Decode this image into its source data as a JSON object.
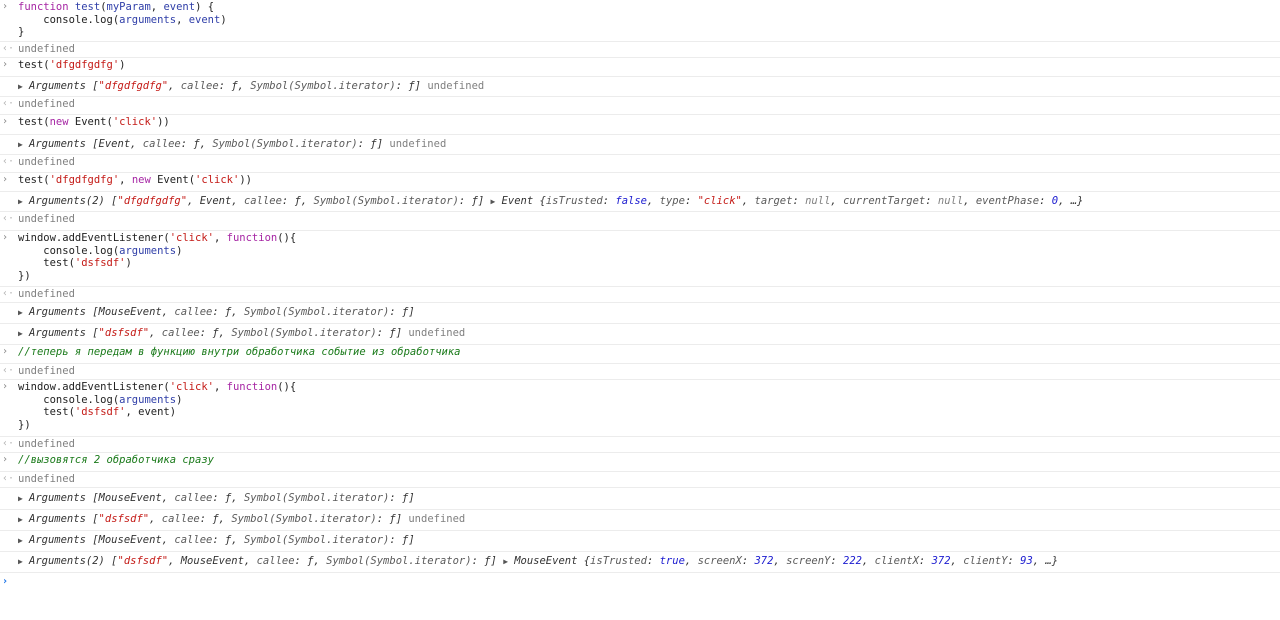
{
  "symbols": {
    "input": "›",
    "result": "‹·",
    "expand": "▶",
    "prompt": "›"
  },
  "icons": {
    "input": "chevron-right-icon",
    "result": "return-arrow-icon",
    "expand": "expand-triangle-icon",
    "prompt": "prompt-caret-icon"
  },
  "colors": {
    "keyword": "#a626a4",
    "function_name": "#2f3ea8",
    "string": "#c41a16",
    "comment": "#1a7a1a",
    "undefined": "#808080",
    "number": "#1c1cd0",
    "prompt": "#1a73e8"
  },
  "console": {
    "entries": [
      {
        "kind": "input",
        "lines": [
          [
            [
              "k",
              "function"
            ],
            [
              "p",
              " "
            ],
            [
              "fn",
              "test"
            ],
            [
              "p",
              "("
            ],
            [
              "fn",
              "myParam"
            ],
            [
              "p",
              ", "
            ],
            [
              "fn",
              "event"
            ],
            [
              "p",
              ") {"
            ]
          ],
          [
            [
              "p",
              "    console.log("
            ],
            [
              "fn",
              "arguments"
            ],
            [
              "p",
              ", "
            ],
            [
              "fn",
              "event"
            ],
            [
              "p",
              ")"
            ]
          ],
          [
            [
              "p",
              "}"
            ]
          ]
        ]
      },
      {
        "kind": "result",
        "lines": [
          [
            [
              "u",
              "undefined"
            ]
          ]
        ]
      },
      {
        "kind": "input",
        "lines": [
          [
            [
              "p",
              "test("
            ],
            [
              "s",
              "'dfgdfgdfg'"
            ],
            [
              "p",
              ")"
            ]
          ]
        ]
      },
      {
        "kind": "log",
        "lines": [
          [
            [
              "t",
              "▶"
            ],
            [
              "o",
              "Arguments ["
            ],
            [
              "ps",
              "\"dfgdfgdfg\""
            ],
            [
              "o",
              ", "
            ],
            [
              "ok",
              "callee"
            ],
            [
              "o",
              ": ƒ, "
            ],
            [
              "ok",
              "Symbol(Symbol.iterator)"
            ],
            [
              "o",
              ": ƒ]"
            ],
            [
              "p",
              " "
            ],
            [
              "u",
              "undefined"
            ]
          ]
        ]
      },
      {
        "kind": "result",
        "lines": [
          [
            [
              "u",
              "undefined"
            ]
          ]
        ]
      },
      {
        "kind": "input",
        "lines": [
          [
            [
              "p",
              "test("
            ],
            [
              "k",
              "new"
            ],
            [
              "p",
              " Event("
            ],
            [
              "s",
              "'click'"
            ],
            [
              "p",
              "))"
            ]
          ]
        ]
      },
      {
        "kind": "log",
        "lines": [
          [
            [
              "t",
              "▶"
            ],
            [
              "o",
              "Arguments [Event, "
            ],
            [
              "ok",
              "callee"
            ],
            [
              "o",
              ": ƒ, "
            ],
            [
              "ok",
              "Symbol(Symbol.iterator)"
            ],
            [
              "o",
              ": ƒ]"
            ],
            [
              "p",
              " "
            ],
            [
              "u",
              "undefined"
            ]
          ]
        ]
      },
      {
        "kind": "result",
        "lines": [
          [
            [
              "u",
              "undefined"
            ]
          ]
        ]
      },
      {
        "kind": "input",
        "lines": [
          [
            [
              "p",
              "test("
            ],
            [
              "s",
              "'dfgdfgdfg'"
            ],
            [
              "p",
              ", "
            ],
            [
              "k",
              "new"
            ],
            [
              "p",
              " Event("
            ],
            [
              "s",
              "'click'"
            ],
            [
              "p",
              "))"
            ]
          ]
        ]
      },
      {
        "kind": "log",
        "lines": [
          [
            [
              "t",
              "▶"
            ],
            [
              "o",
              "Arguments(2) ["
            ],
            [
              "ps",
              "\"dfgdfgdfg\""
            ],
            [
              "o",
              ", Event, "
            ],
            [
              "ok",
              "callee"
            ],
            [
              "o",
              ": ƒ, "
            ],
            [
              "ok",
              "Symbol(Symbol.iterator)"
            ],
            [
              "o",
              ": ƒ]"
            ],
            [
              "p",
              " "
            ],
            [
              "t",
              "▶"
            ],
            [
              "o",
              "Event {"
            ],
            [
              "ok",
              "isTrusted"
            ],
            [
              "o",
              ": "
            ],
            [
              "b",
              "false"
            ],
            [
              "o",
              ", "
            ],
            [
              "ok",
              "type"
            ],
            [
              "o",
              ": "
            ],
            [
              "ps",
              "\"click\""
            ],
            [
              "o",
              ", "
            ],
            [
              "ok",
              "target"
            ],
            [
              "o",
              ": "
            ],
            [
              "n",
              "null"
            ],
            [
              "o",
              ", "
            ],
            [
              "ok",
              "currentTarget"
            ],
            [
              "o",
              ": "
            ],
            [
              "n",
              "null"
            ],
            [
              "o",
              ", "
            ],
            [
              "ok",
              "eventPhase"
            ],
            [
              "o",
              ": "
            ],
            [
              "num",
              "0"
            ],
            [
              "o",
              ", …}"
            ]
          ]
        ]
      },
      {
        "kind": "result",
        "lines": [
          [
            [
              "u",
              "undefined"
            ]
          ]
        ]
      },
      {
        "kind": "input",
        "lines": [
          [
            [
              "p",
              "window.addEventListener("
            ],
            [
              "s",
              "'click'"
            ],
            [
              "p",
              ", "
            ],
            [
              "k",
              "function"
            ],
            [
              "p",
              "(){"
            ]
          ],
          [
            [
              "p",
              "    console.log("
            ],
            [
              "fn",
              "arguments"
            ],
            [
              "p",
              ")"
            ]
          ],
          [
            [
              "p",
              "    test("
            ],
            [
              "s",
              "'dsfsdf'"
            ],
            [
              "p",
              ")"
            ]
          ],
          [
            [
              "p",
              "})"
            ]
          ]
        ]
      },
      {
        "kind": "result",
        "lines": [
          [
            [
              "u",
              "undefined"
            ]
          ]
        ]
      },
      {
        "kind": "log",
        "lines": [
          [
            [
              "t",
              "▶"
            ],
            [
              "o",
              "Arguments [MouseEvent, "
            ],
            [
              "ok",
              "callee"
            ],
            [
              "o",
              ": ƒ, "
            ],
            [
              "ok",
              "Symbol(Symbol.iterator)"
            ],
            [
              "o",
              ": ƒ]"
            ]
          ]
        ]
      },
      {
        "kind": "log",
        "lines": [
          [
            [
              "t",
              "▶"
            ],
            [
              "o",
              "Arguments ["
            ],
            [
              "ps",
              "\"dsfsdf\""
            ],
            [
              "o",
              ", "
            ],
            [
              "ok",
              "callee"
            ],
            [
              "o",
              ": ƒ, "
            ],
            [
              "ok",
              "Symbol(Symbol.iterator)"
            ],
            [
              "o",
              ": ƒ]"
            ],
            [
              "p",
              " "
            ],
            [
              "u",
              "undefined"
            ]
          ]
        ]
      },
      {
        "kind": "input",
        "lines": [
          [
            [
              "c",
              "//теперь я передам в функцию внутри обработчика событие из обработчика"
            ]
          ]
        ]
      },
      {
        "kind": "result",
        "lines": [
          [
            [
              "u",
              "undefined"
            ]
          ]
        ]
      },
      {
        "kind": "input",
        "lines": [
          [
            [
              "p",
              "window.addEventListener("
            ],
            [
              "s",
              "'click'"
            ],
            [
              "p",
              ", "
            ],
            [
              "k",
              "function"
            ],
            [
              "p",
              "(){"
            ]
          ],
          [
            [
              "p",
              "    console.log("
            ],
            [
              "fn",
              "arguments"
            ],
            [
              "p",
              ")"
            ]
          ],
          [
            [
              "p",
              "    test("
            ],
            [
              "s",
              "'dsfsdf'"
            ],
            [
              "p",
              ", event)"
            ]
          ],
          [
            [
              "p",
              "})"
            ]
          ]
        ]
      },
      {
        "kind": "result",
        "lines": [
          [
            [
              "u",
              "undefined"
            ]
          ]
        ]
      },
      {
        "kind": "input",
        "lines": [
          [
            [
              "c",
              "//вызовятся 2 обработчика сразу"
            ]
          ]
        ]
      },
      {
        "kind": "result",
        "lines": [
          [
            [
              "u",
              "undefined"
            ]
          ]
        ]
      },
      {
        "kind": "log",
        "lines": [
          [
            [
              "t",
              "▶"
            ],
            [
              "o",
              "Arguments [MouseEvent, "
            ],
            [
              "ok",
              "callee"
            ],
            [
              "o",
              ": ƒ, "
            ],
            [
              "ok",
              "Symbol(Symbol.iterator)"
            ],
            [
              "o",
              ": ƒ]"
            ]
          ]
        ]
      },
      {
        "kind": "log",
        "lines": [
          [
            [
              "t",
              "▶"
            ],
            [
              "o",
              "Arguments ["
            ],
            [
              "ps",
              "\"dsfsdf\""
            ],
            [
              "o",
              ", "
            ],
            [
              "ok",
              "callee"
            ],
            [
              "o",
              ": ƒ, "
            ],
            [
              "ok",
              "Symbol(Symbol.iterator)"
            ],
            [
              "o",
              ": ƒ]"
            ],
            [
              "p",
              " "
            ],
            [
              "u",
              "undefined"
            ]
          ]
        ]
      },
      {
        "kind": "log",
        "lines": [
          [
            [
              "t",
              "▶"
            ],
            [
              "o",
              "Arguments [MouseEvent, "
            ],
            [
              "ok",
              "callee"
            ],
            [
              "o",
              ": ƒ, "
            ],
            [
              "ok",
              "Symbol(Symbol.iterator)"
            ],
            [
              "o",
              ": ƒ]"
            ]
          ]
        ]
      },
      {
        "kind": "log",
        "lines": [
          [
            [
              "t",
              "▶"
            ],
            [
              "o",
              "Arguments(2) ["
            ],
            [
              "ps",
              "\"dsfsdf\""
            ],
            [
              "o",
              ", MouseEvent, "
            ],
            [
              "ok",
              "callee"
            ],
            [
              "o",
              ": ƒ, "
            ],
            [
              "ok",
              "Symbol(Symbol.iterator)"
            ],
            [
              "o",
              ": ƒ]"
            ],
            [
              "p",
              " "
            ],
            [
              "t",
              "▶"
            ],
            [
              "o",
              "MouseEvent {"
            ],
            [
              "ok",
              "isTrusted"
            ],
            [
              "o",
              ": "
            ],
            [
              "b",
              "true"
            ],
            [
              "o",
              ", "
            ],
            [
              "ok",
              "screenX"
            ],
            [
              "o",
              ": "
            ],
            [
              "num",
              "372"
            ],
            [
              "o",
              ", "
            ],
            [
              "ok",
              "screenY"
            ],
            [
              "o",
              ": "
            ],
            [
              "num",
              "222"
            ],
            [
              "o",
              ", "
            ],
            [
              "ok",
              "clientX"
            ],
            [
              "o",
              ": "
            ],
            [
              "num",
              "372"
            ],
            [
              "o",
              ", "
            ],
            [
              "ok",
              "clientY"
            ],
            [
              "o",
              ": "
            ],
            [
              "num",
              "93"
            ],
            [
              "o",
              ", …}"
            ]
          ]
        ]
      },
      {
        "kind": "prompt",
        "lines": [
          [
            [
              "p",
              ""
            ]
          ]
        ]
      }
    ]
  }
}
